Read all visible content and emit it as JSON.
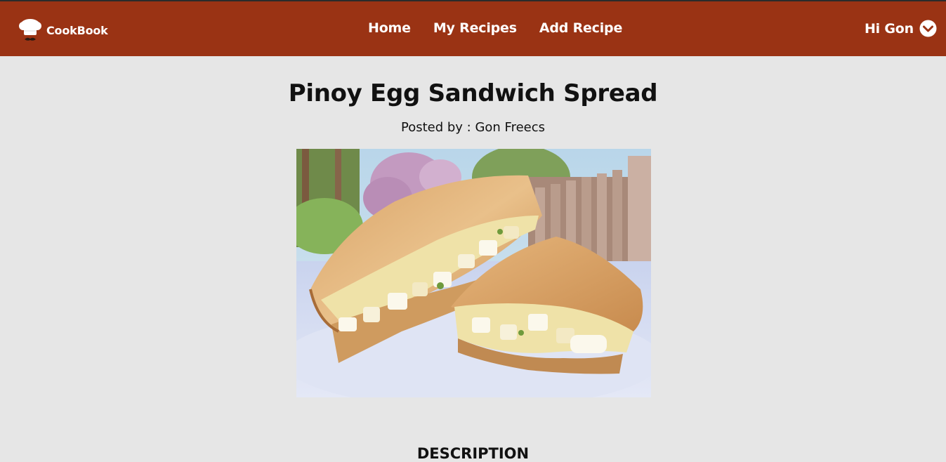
{
  "app": {
    "brand": "CookBook"
  },
  "nav": {
    "links": [
      "Home",
      "My Recipes",
      "Add Recipe"
    ]
  },
  "user": {
    "greeting": "Hi Gon",
    "menu_icon": "chevron-down-circle-icon"
  },
  "recipe": {
    "title": "Pinoy Egg Sandwich Spread",
    "posted_by": "Posted by : Gon Freecs",
    "image_alt": "Pinoy Egg Sandwich Spread photo"
  },
  "sections": {
    "description_heading": "DESCRIPTION"
  },
  "colors": {
    "navbar": "#9a3314",
    "background": "#e6e6e6",
    "text": "#111111",
    "nav_text": "#ffffff"
  }
}
